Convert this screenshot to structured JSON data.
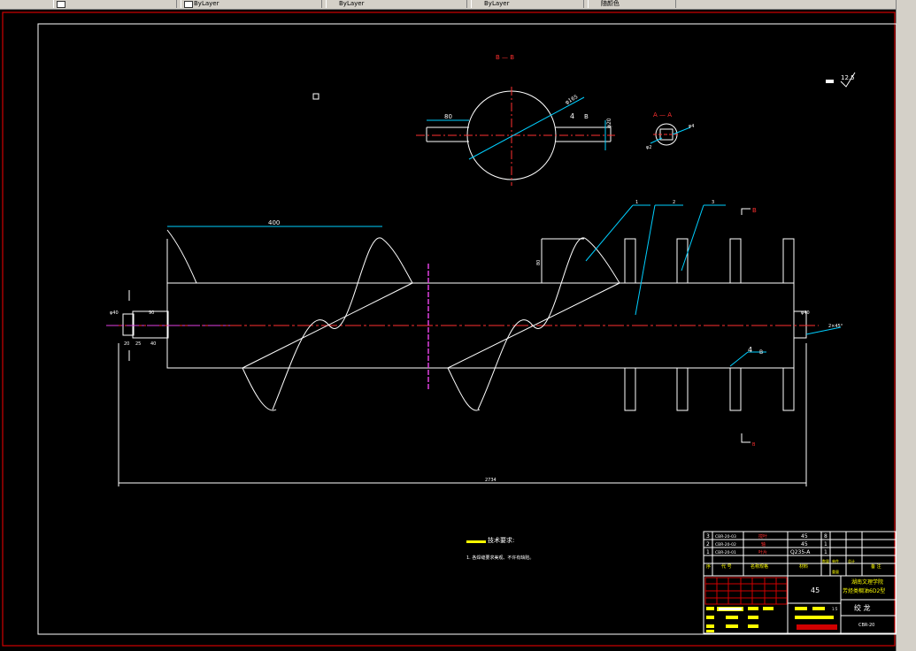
{
  "toolbar": {
    "items": [
      "ByLayer",
      "ByLayer",
      "ByLayer",
      "ByLayer",
      "随颜色"
    ]
  },
  "drawing": {
    "section_label_top": "B — B",
    "section_label_small": "A — A",
    "roughness": "12.5",
    "dims": {
      "pitch": "400",
      "total_length": "2734",
      "key_width": "80",
      "circle_dia": "φ165",
      "key_depth": "φ20",
      "flight_height": "80",
      "shaft_left": "φ40",
      "shaft_right": "φ40",
      "small_a": "φ4",
      "small_b": "φ2",
      "right_note": "2×45°",
      "left_vals": [
        "20",
        "25",
        "40",
        "90"
      ],
      "mark_b_top": "B",
      "mark_b_bottom": "B"
    },
    "balloons": [
      "1",
      "2",
      "3"
    ],
    "weld_symbol": "4",
    "weld_label": "B",
    "tech_title": "技术要求:",
    "tech_note": "1. 各焊缝要求美观、不许有缺陷。"
  },
  "title_block": {
    "parts": [
      {
        "no": "3",
        "code": "CBR-20-03",
        "name": "搅叶",
        "material": "45",
        "qty": "8"
      },
      {
        "no": "2",
        "code": "CBR-20-02",
        "name": "轴",
        "material": "45",
        "qty": "1"
      },
      {
        "no": "1",
        "code": "CBR-20-01",
        "name": "叶片",
        "material": "Q235-A",
        "qty": "1"
      }
    ],
    "header": {
      "no": "序",
      "code": "代 号",
      "name": "名称规格",
      "material": "材料",
      "qty": "数量",
      "unit_weight": "单件",
      "total_weight": "总计",
      "note": "备 注"
    },
    "weight_label": "重量",
    "school": "湖南文理学院",
    "design_title": "芳烃类稠油6D2型",
    "material": "45",
    "drawing_name": "绞 龙",
    "drawing_code": "CBR-20",
    "scale": "1:5"
  }
}
